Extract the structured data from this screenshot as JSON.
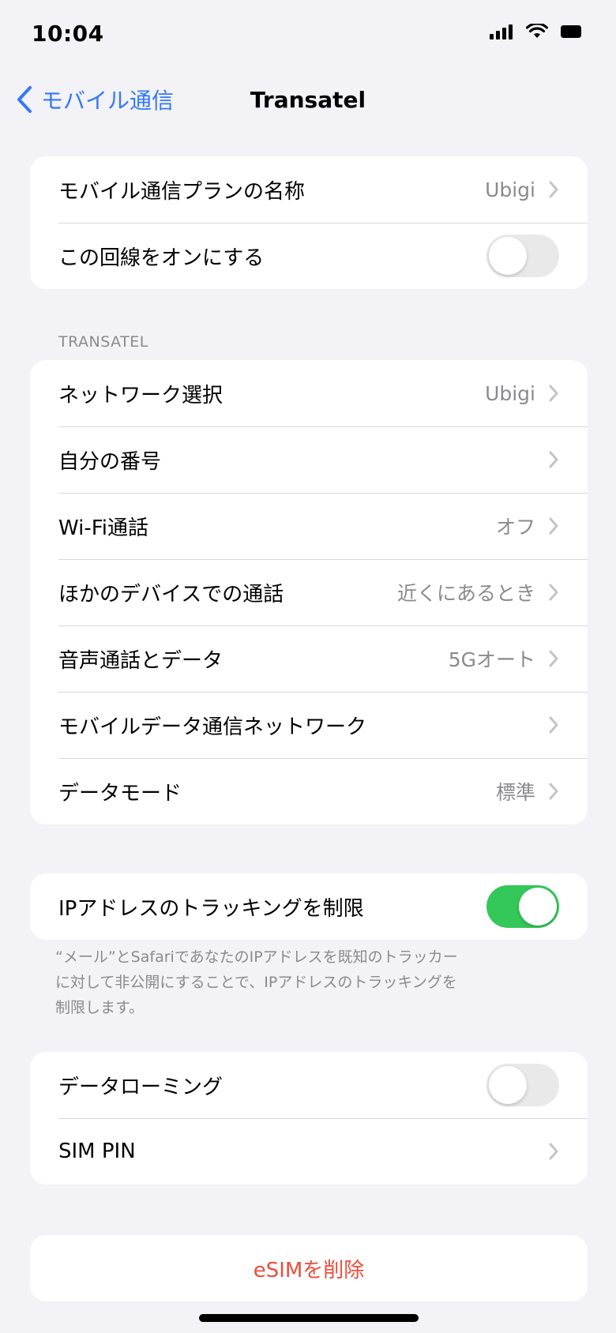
{
  "status_bar": {
    "time": "10:04"
  },
  "nav": {
    "back_label": "モバイル通信",
    "title": "Transatel"
  },
  "group1": {
    "plan_name_label": "モバイル通信プランの名称",
    "plan_name_value": "Ubigi",
    "line_on_label": "この回線をオンにする",
    "line_on_state": false
  },
  "section_header": "TRANSATEL",
  "group2": {
    "rows": [
      {
        "label": "ネットワーク選択",
        "value": "Ubigi"
      },
      {
        "label": "自分の番号",
        "value": ""
      },
      {
        "label": "Wi-Fi通話",
        "value": "オフ"
      },
      {
        "label": "ほかのデバイスでの通話",
        "value": "近くにあるとき"
      },
      {
        "label": "音声通話とデータ",
        "value": "5Gオート"
      },
      {
        "label": "モバイルデータ通信ネットワーク",
        "value": ""
      },
      {
        "label": "データモード",
        "value": "標準"
      }
    ]
  },
  "group3": {
    "limit_ip_label": "IPアドレスのトラッキングを制限",
    "limit_ip_state": true,
    "footnote_lines": [
      "“メール”とSafariであなたのIPアドレスを既知のトラッカー",
      "に対して非公開にすることで、IPアドレスのトラッキングを",
      "制限します。"
    ]
  },
  "group4": {
    "roaming_label": "データローミング",
    "roaming_state": false,
    "sim_pin_label": "SIM PIN"
  },
  "delete_esim_label": "eSIMを削除",
  "colors": {
    "accent": "#3478f6",
    "toggle_on": "#34c759",
    "destructive": "#eb4e3d"
  },
  "icons": [
    "signal-icon",
    "wifi-icon",
    "battery-icon",
    "back-chevron-icon",
    "chevron-right-icon"
  ]
}
